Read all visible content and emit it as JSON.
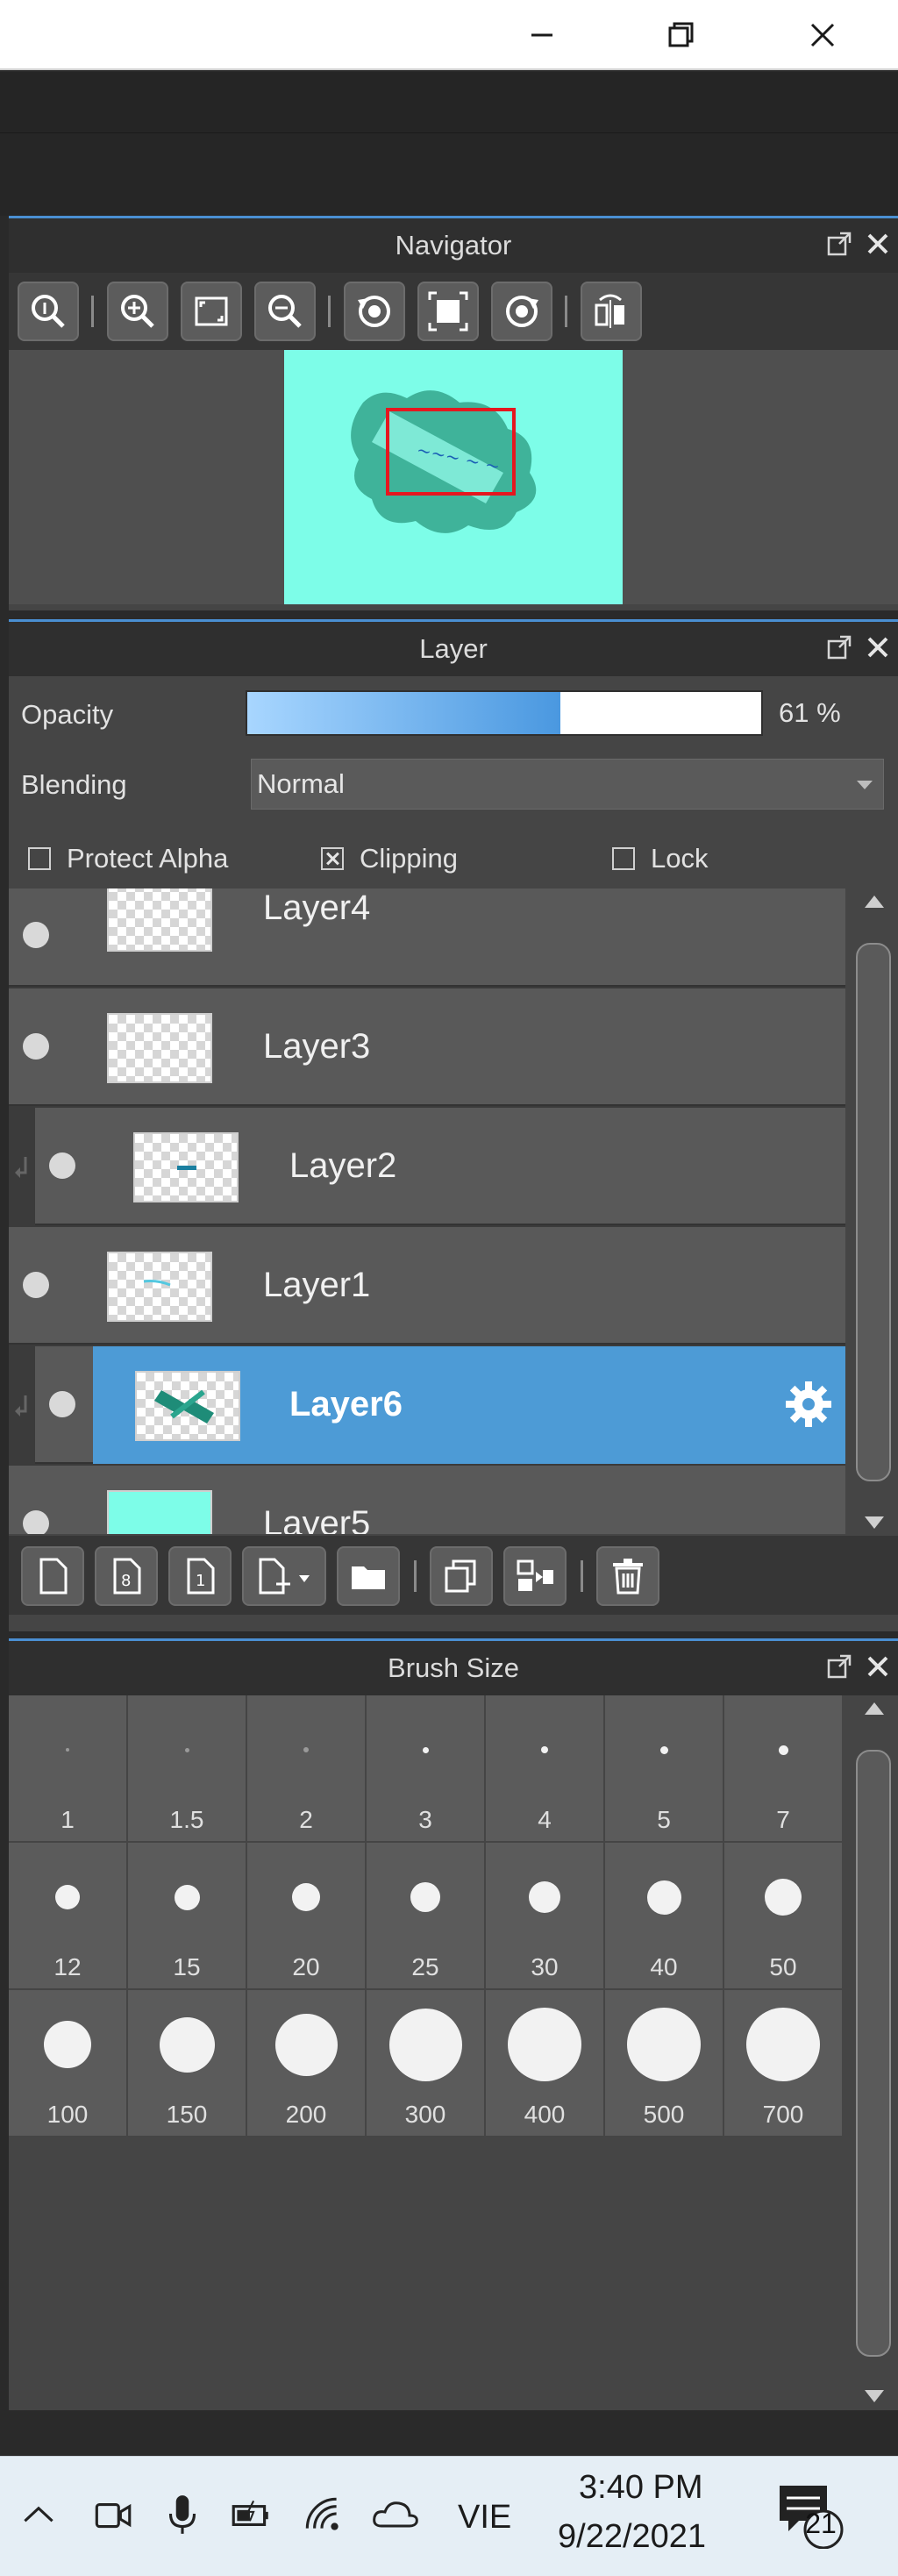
{
  "window": {
    "controls": [
      "minimize-icon",
      "restore-icon",
      "close-icon"
    ]
  },
  "navigator": {
    "title": "Navigator",
    "toolbar": [
      "zoom-actual-icon",
      "zoom-in-icon",
      "fit-icon",
      "zoom-out-icon",
      "rotate-left-icon",
      "fit-to-window-icon",
      "rotate-right-icon",
      "flip-icon"
    ],
    "canvas_color": "#7dfde8"
  },
  "layer_panel": {
    "title": "Layer",
    "opacity_label": "Opacity",
    "opacity_value": "61 %",
    "opacity_fraction": 0.61,
    "blending_label": "Blending",
    "blending_value": "Normal",
    "protect_alpha_label": "Protect Alpha",
    "protect_alpha_checked": false,
    "clipping_label": "Clipping",
    "clipping_checked": true,
    "lock_label": "Lock",
    "lock_checked": false,
    "layers": [
      {
        "name": "Layer4",
        "clipped": false,
        "selected": false
      },
      {
        "name": "Layer3",
        "clipped": false,
        "selected": false
      },
      {
        "name": "Layer2",
        "clipped": true,
        "selected": false
      },
      {
        "name": "Layer1",
        "clipped": false,
        "selected": false
      },
      {
        "name": "Layer6",
        "clipped": true,
        "selected": true
      },
      {
        "name": "Layer5",
        "clipped": false,
        "selected": false
      }
    ],
    "toolbar": [
      "new-layer-icon",
      "new-8bit-layer-icon",
      "new-1bit-layer-icon",
      "add-layer-menu-icon",
      "new-folder-icon",
      "duplicate-layer-icon",
      "merge-down-icon",
      "delete-layer-icon"
    ]
  },
  "brush_size": {
    "title": "Brush Size",
    "sizes": [
      "1",
      "1.5",
      "2",
      "3",
      "4",
      "5",
      "7",
      "12",
      "15",
      "20",
      "25",
      "30",
      "40",
      "50",
      "100",
      "150",
      "200",
      "300",
      "400",
      "500",
      "700"
    ]
  },
  "taskbar": {
    "icons": [
      "chevron-up-icon",
      "meet-now-icon",
      "microphone-icon",
      "battery-icon",
      "wifi-icon",
      "onedrive-icon"
    ],
    "language": "VIE",
    "time": "3:40 PM",
    "date": "9/22/2021",
    "notifications": "21"
  },
  "colors": {
    "accent": "#4a8fd2",
    "selected_layer": "#4d9bd6",
    "panel_bg": "#454545"
  }
}
